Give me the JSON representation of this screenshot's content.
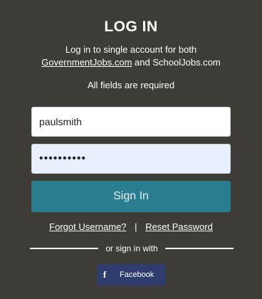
{
  "header": {
    "title": "LOG IN",
    "subtitle_line1": "Log in to single account for both",
    "site_link_1": "GovernmentJobs.com",
    "and_text": "and",
    "site_link_2": "SchoolJobs.com",
    "required_note": "All fields are required"
  },
  "form": {
    "username_value": "paulsmith",
    "password_value": "••••••••••",
    "sign_in_label": "Sign In"
  },
  "links": {
    "forgot_username": "Forgot Username?",
    "separator": "|",
    "reset_password": "Reset Password"
  },
  "social": {
    "divider_text": "or sign in with",
    "facebook_icon": "f",
    "facebook_label": "Facebook"
  },
  "colors": {
    "background": "#3d3c36",
    "sign_in_button": "#2a7c8f",
    "facebook_button": "#2f3d6e",
    "password_field_bg": "#e8f0fe"
  }
}
